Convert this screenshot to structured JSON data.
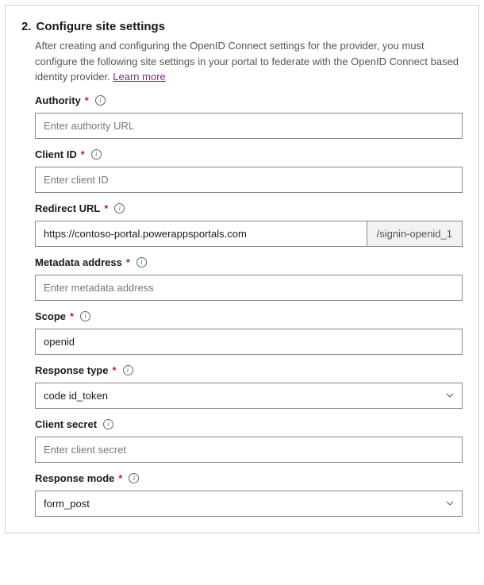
{
  "stepNumber": "2.",
  "stepTitle": "Configure site settings",
  "description": "After creating and configuring the OpenID Connect settings for the provider, you must configure the following site settings in your portal to federate with the OpenID Connect based identity provider. ",
  "learnMore": "Learn more",
  "fields": {
    "authority": {
      "label": "Authority",
      "placeholder": "Enter authority URL",
      "value": "",
      "required": "*"
    },
    "clientId": {
      "label": "Client ID",
      "placeholder": "Enter client ID",
      "value": "",
      "required": "*"
    },
    "redirect": {
      "label": "Redirect URL",
      "value": "https://contoso-portal.powerappsportals.com",
      "suffix": "/signin-openid_1",
      "required": "*"
    },
    "metadata": {
      "label": "Metadata address",
      "placeholder": "Enter metadata address",
      "value": "",
      "required": "*"
    },
    "scope": {
      "label": "Scope",
      "value": "openid",
      "required": "*"
    },
    "responseType": {
      "label": "Response type",
      "value": "code id_token",
      "required": "*"
    },
    "clientSecret": {
      "label": "Client secret",
      "placeholder": "Enter client secret",
      "value": ""
    },
    "responseMode": {
      "label": "Response mode",
      "value": "form_post",
      "required": "*"
    }
  }
}
